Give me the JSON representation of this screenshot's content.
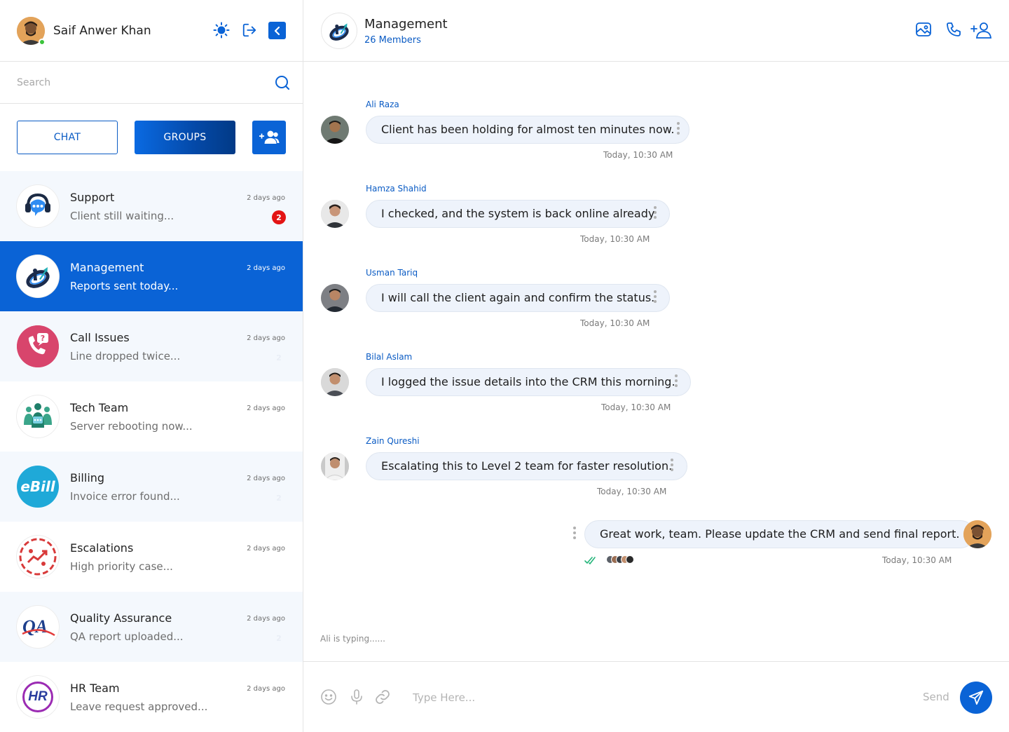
{
  "user": {
    "name": "Saif Anwer Khan",
    "status": "online"
  },
  "header_icons": [
    "sun-icon",
    "logout-icon",
    "collapse-icon"
  ],
  "search": {
    "placeholder": "Search"
  },
  "tabs": {
    "chat": "CHAT",
    "groups": "GROUPS",
    "active": "groups"
  },
  "groups": [
    {
      "name": "Support",
      "preview": "Client still waiting...",
      "time": "2 days ago",
      "unread": "2",
      "unread_visible": true,
      "active": false
    },
    {
      "name": "Management",
      "preview": "Reports sent today...",
      "time": "2 days ago",
      "unread": "",
      "unread_visible": false,
      "active": true
    },
    {
      "name": "Call Issues",
      "preview": "Line dropped twice...",
      "time": "2 days ago",
      "unread": "2",
      "unread_visible": false,
      "active": false
    },
    {
      "name": "Tech Team",
      "preview": "Server rebooting now...",
      "time": "2 days ago",
      "unread": "",
      "unread_visible": false,
      "active": false
    },
    {
      "name": "Billing",
      "preview": "Invoice error found...",
      "time": "2 days ago",
      "unread": "2",
      "unread_visible": false,
      "active": false
    },
    {
      "name": "Escalations",
      "preview": "High priority case...",
      "time": "2 days ago",
      "unread": "",
      "unread_visible": false,
      "active": false
    },
    {
      "name": "Quality Assurance",
      "preview": "QA report uploaded...",
      "time": "2 days ago",
      "unread": "2",
      "unread_visible": false,
      "active": false
    },
    {
      "name": "HR Team",
      "preview": "Leave request approved...",
      "time": "2 days ago",
      "unread": "",
      "unread_visible": false,
      "active": false
    }
  ],
  "group_logos": {
    "billing": "eBill",
    "qa": "QA",
    "hr": "HR"
  },
  "chat": {
    "title": "Management",
    "members": "26 Members",
    "actions": [
      "media-icon",
      "phone-icon",
      "add-member-icon"
    ]
  },
  "messages": [
    {
      "sender": "Ali Raza",
      "text": "Client has been holding for almost ten minutes now.",
      "time": "Today, 10:30 AM",
      "mine": false
    },
    {
      "sender": "Hamza Shahid",
      "text": "I checked, and the system is back online already",
      "time": "Today, 10:30 AM",
      "mine": false
    },
    {
      "sender": "Usman Tariq",
      "text": "I will call the client again and confirm the status.",
      "time": "Today, 10:30 AM",
      "mine": false
    },
    {
      "sender": "Bilal Aslam",
      "text": "I logged the issue details into the CRM this morning.",
      "time": "Today, 10:30 AM",
      "mine": false
    },
    {
      "sender": "Zain Qureshi",
      "text": "Escalating this to Level 2 team for faster resolution.",
      "time": "Today, 10:30 AM",
      "mine": false
    },
    {
      "sender": "",
      "text": "Great work, team. Please update the CRM and send final report.",
      "time": "Today, 10:30 AM",
      "mine": true
    }
  ],
  "typing": "Ali is typing......",
  "composer": {
    "placeholder": "Type Here...",
    "send_label": "Send"
  },
  "colors": {
    "primary": "#0a63d6",
    "badge": "#e31414",
    "bubble": "#eef3fb",
    "sender": "#0a5bc4"
  }
}
